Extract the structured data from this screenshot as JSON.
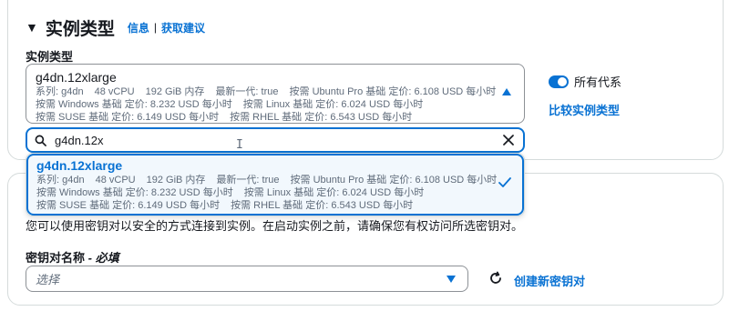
{
  "section": {
    "title": "实例类型",
    "info_link": "信息",
    "separator": "|",
    "recommend_link": "获取建议"
  },
  "instance_type": {
    "label": "实例类型",
    "selected": {
      "title": "g4dn.12xlarge",
      "line1": [
        "系列: g4dn",
        "48 vCPU",
        "192 GiB 内存",
        "最新一代: true",
        "按需 Ubuntu Pro 基础 定价: 6.108 USD 每小时"
      ],
      "line2": [
        "按需 Windows 基础 定价: 8.232 USD 每小时",
        "按需 Linux 基础 定价: 6.024 USD 每小时"
      ],
      "line3": [
        "按需 SUSE 基础 定价: 6.149 USD 每小时",
        "按需 RHEL 基础 定价: 6.543 USD 每小时"
      ]
    },
    "all_generations_label": "所有代系",
    "all_generations_on": true,
    "compare_link": "比较实例类型"
  },
  "search": {
    "value": "g4dn.12x"
  },
  "dropdown": {
    "options": [
      {
        "title": "g4dn.12xlarge",
        "line1": [
          "系列: g4dn",
          "48 vCPU",
          "192 GiB 内存",
          "最新一代: true",
          "按需 Ubuntu Pro 基础 定价: 6.108 USD 每小时"
        ],
        "line2": [
          "按需 Windows 基础 定价: 8.232 USD 每小时",
          "按需 Linux 基础 定价: 6.024 USD 每小时"
        ],
        "line3": [
          "按需 SUSE 基础 定价: 6.149 USD 每小时",
          "按需 RHEL 基础 定价: 6.543 USD 每小时"
        ],
        "selected": true
      }
    ]
  },
  "key_pair": {
    "description": "您可以使用密钥对以安全的方式连接到实例。在启动实例之前，请确保您有权访问所选密钥对。",
    "label": "密钥对名称",
    "required_suffix": " - 必填",
    "placeholder": "选择",
    "create_link": "创建新密钥对"
  },
  "colors": {
    "accent": "#0972d3",
    "text": "#16191f",
    "muted": "#5f6b7a",
    "border": "#8d9196",
    "highlight_bg": "#f2f8fd"
  },
  "icons": {
    "section_caret": "▼",
    "search": "search-icon",
    "clear": "close-icon",
    "check": "check-icon",
    "refresh": "refresh-icon",
    "text_cursor": "I"
  }
}
